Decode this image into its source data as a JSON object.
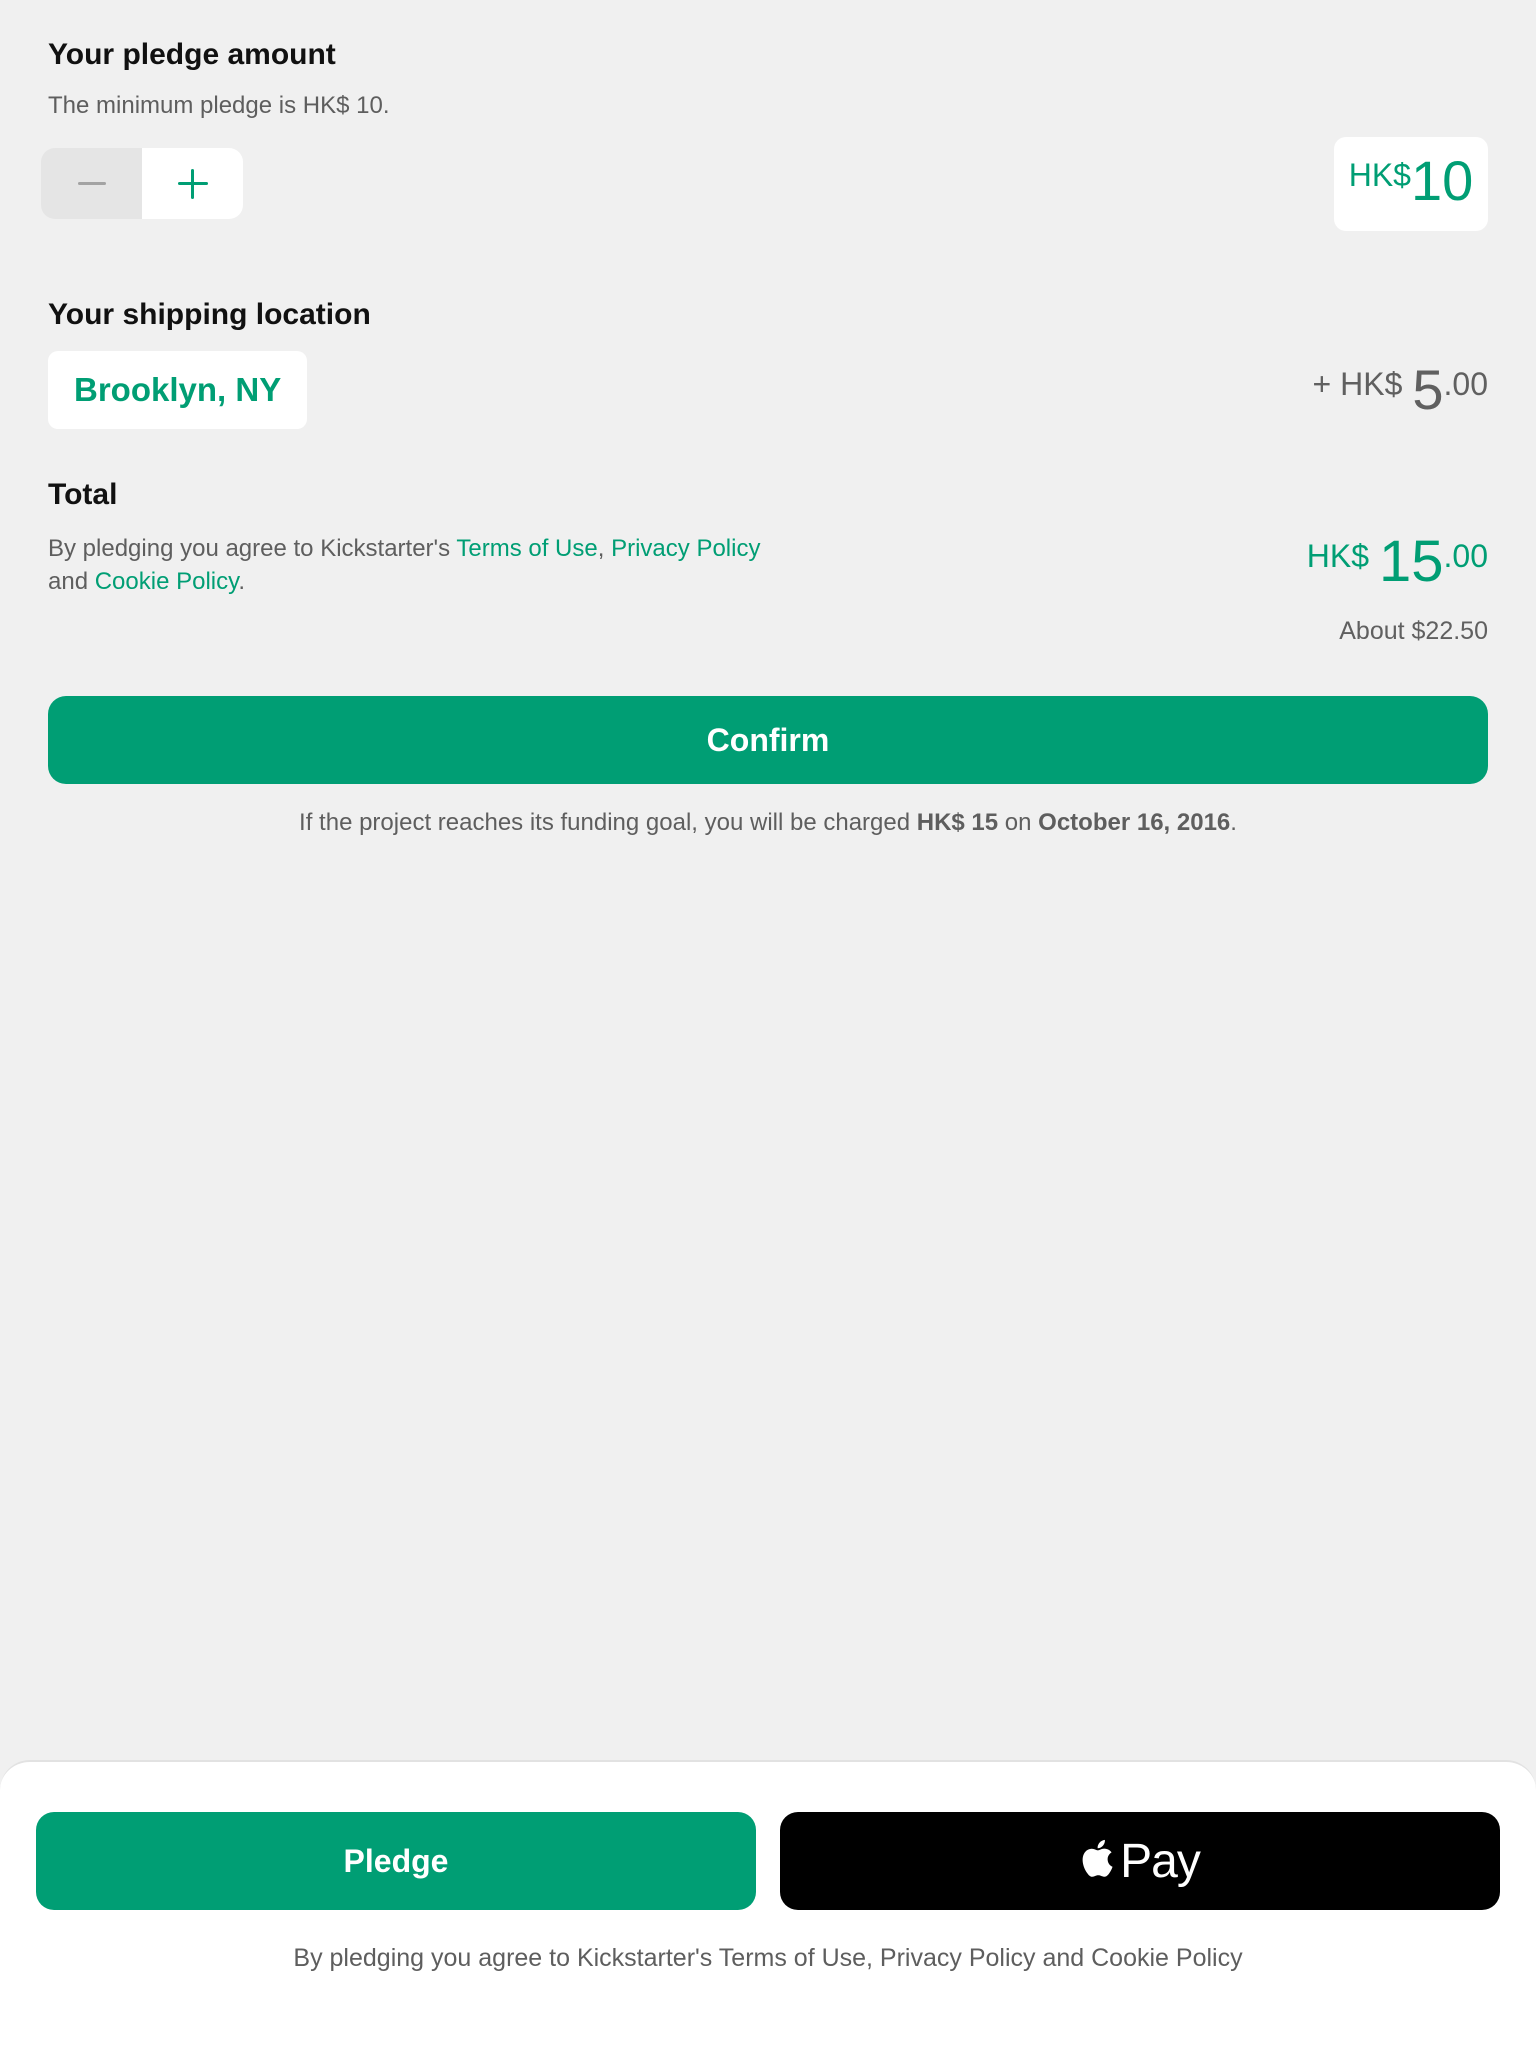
{
  "pledge": {
    "heading": "Your pledge amount",
    "minimum_note": "The minimum pledge is HK$ 10.",
    "amount_currency": "HK$",
    "amount_value": "10"
  },
  "shipping": {
    "heading": "Your shipping location",
    "location": "Brooklyn, NY",
    "price_prefix": "+ HK$",
    "price_int": "5",
    "price_dec": ".00"
  },
  "total": {
    "heading": "Total",
    "terms_prefix": "By pledging you agree to Kickstarter's ",
    "terms_link": "Terms of Use",
    "sep1": ", ",
    "privacy_link": "Privacy Policy",
    "sep2": " and ",
    "cookie_link": "Cookie Policy",
    "end": ".",
    "price_prefix": "HK$",
    "price_int": "15",
    "price_dec": ".00",
    "about": "About $22.50"
  },
  "confirm_label": "Confirm",
  "charge_note": {
    "prefix": "If the project reaches its funding goal, you will be charged ",
    "amount": "HK$ 15",
    "middle": " on ",
    "date": "October 16, 2016",
    "end": "."
  },
  "footer": {
    "pledge_label": "Pledge",
    "applepay_label": "Pay",
    "terms": "By pledging you agree to Kickstarter's Terms of Use, Privacy Policy and Cookie Policy"
  },
  "colors": {
    "accent": "#009e74",
    "background": "#f0f0f0",
    "text_muted": "#5e5e5e"
  },
  "icons": [
    "minus-icon",
    "plus-icon",
    "apple-icon"
  ]
}
